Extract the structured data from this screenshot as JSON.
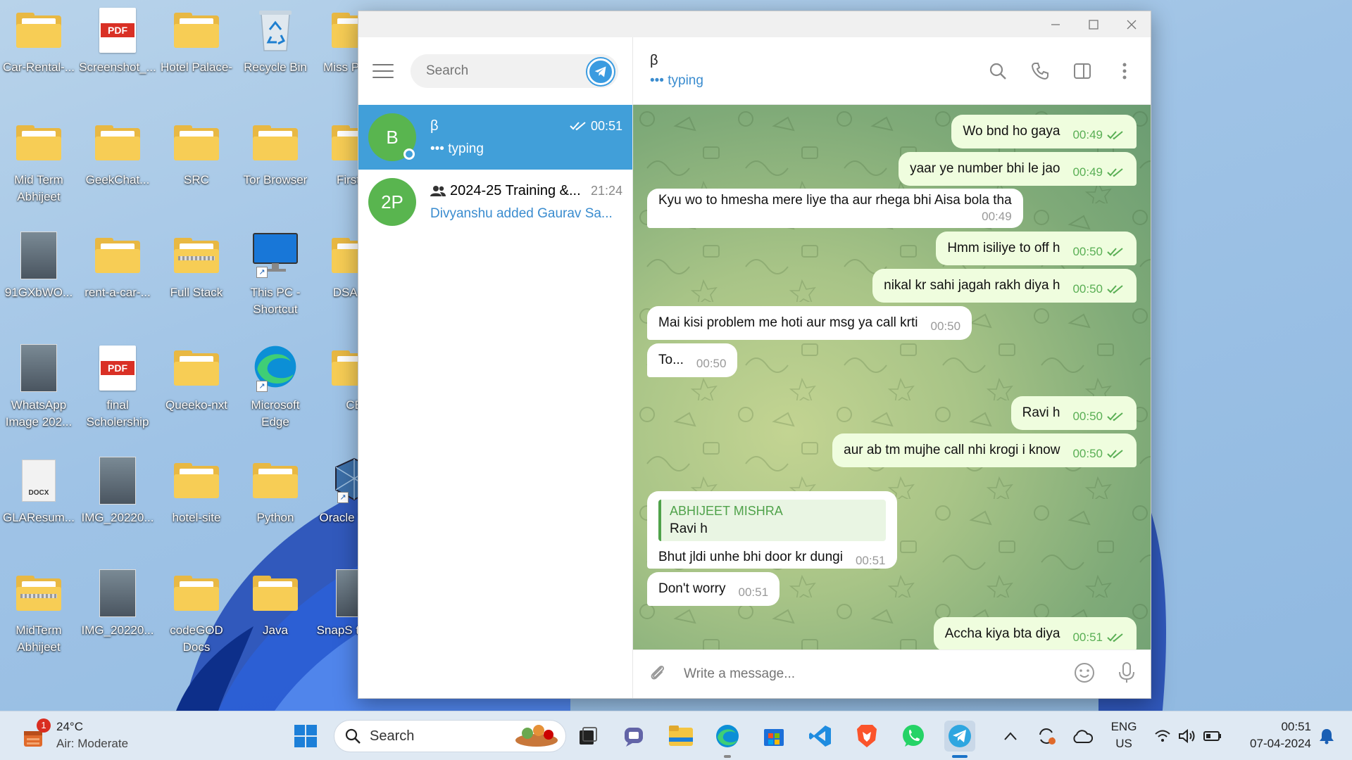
{
  "desktop": {
    "icons": [
      {
        "label": "Car-Rental-...",
        "type": "folder"
      },
      {
        "label": "Screenshot_...",
        "type": "pdf"
      },
      {
        "label": "Hotel Palace-",
        "type": "folder"
      },
      {
        "label": "Recycle Bin",
        "type": "recycle-bin"
      },
      {
        "label": "Miss Projec",
        "type": "folder"
      },
      {
        "label": "Mid Term Abhijeet",
        "type": "folder"
      },
      {
        "label": "GeekChat...",
        "type": "folder"
      },
      {
        "label": "SRC",
        "type": "folder"
      },
      {
        "label": "Tor Browser",
        "type": "folder"
      },
      {
        "label": "FirstPr",
        "type": "folder"
      },
      {
        "label": "91GXbWO...",
        "type": "image"
      },
      {
        "label": "rent-a-car-...",
        "type": "folder"
      },
      {
        "label": "Full Stack",
        "type": "zip-folder"
      },
      {
        "label": "This PC - Shortcut",
        "type": "monitor"
      },
      {
        "label": "DSA Co",
        "type": "folder"
      },
      {
        "label": "WhatsApp Image 202...",
        "type": "image"
      },
      {
        "label": "final Scholership",
        "type": "pdf"
      },
      {
        "label": "Queeko-nxt",
        "type": "folder"
      },
      {
        "label": "Microsoft Edge",
        "type": "edge"
      },
      {
        "label": "CE",
        "type": "folder"
      },
      {
        "label": "GLAResum...",
        "type": "docx"
      },
      {
        "label": "IMG_20220...",
        "type": "image"
      },
      {
        "label": "hotel-site",
        "type": "folder"
      },
      {
        "label": "Python",
        "type": "folder"
      },
      {
        "label": "Oracle Virtua",
        "type": "app"
      },
      {
        "label": "MidTerm Abhijeet",
        "type": "zip-folder"
      },
      {
        "label": "IMG_20220...",
        "type": "image"
      },
      {
        "label": "codeGOD Docs",
        "type": "folder"
      },
      {
        "label": "Java",
        "type": "folder"
      },
      {
        "label": "SnapS the BA",
        "type": "image"
      }
    ],
    "pdf_badge": "PDF",
    "docx_badge": "DOCX"
  },
  "telegram": {
    "search_placeholder": "Search",
    "chats": [
      {
        "avatar": "B",
        "name": "β",
        "time": "00:51",
        "preview": "••• typing",
        "active": true
      },
      {
        "avatar": "2P",
        "name": "2024-25 Training &...",
        "time": "21:24",
        "preview": "Divyanshu added Gaurav Sa...",
        "active": false
      }
    ],
    "header": {
      "name": "β",
      "status": "••• typing"
    },
    "messages": [
      {
        "dir": "out",
        "text": "Wo bnd ho gaya",
        "time": "00:49"
      },
      {
        "dir": "out",
        "text": "yaar ye number bhi le jao",
        "time": "00:49"
      },
      {
        "dir": "in",
        "text": "Kyu wo to hmesha mere liye tha aur rhega bhi Aisa bola tha",
        "time": "00:49"
      },
      {
        "dir": "out",
        "text": "Hmm isiliye to off h",
        "time": "00:50"
      },
      {
        "dir": "out",
        "text": "nikal kr sahi jagah rakh diya h",
        "time": "00:50"
      },
      {
        "dir": "in",
        "text": "Mai kisi problem me hoti aur msg ya call krti",
        "time": "00:50"
      },
      {
        "dir": "in",
        "text": "To...",
        "time": "00:50"
      },
      {
        "dir": "out",
        "text": "Ravi h",
        "time": "00:50"
      },
      {
        "dir": "out",
        "text": "aur ab tm mujhe call nhi krogi i know",
        "time": "00:50"
      },
      {
        "dir": "in",
        "reply_name": "ABHIJEET MISHRA",
        "reply_text": "Ravi h",
        "text": "Bhut jldi unhe bhi door kr dungi",
        "time": "00:51"
      },
      {
        "dir": "in",
        "text": "Don't worry",
        "time": "00:51"
      },
      {
        "dir": "out",
        "text": "Accha kiya bta diya",
        "time": "00:51"
      }
    ],
    "composer_placeholder": "Write a message..."
  },
  "taskbar": {
    "weather_temp": "24°C",
    "weather_desc": "Air: Moderate",
    "weather_badge": "1",
    "search_label": "Search",
    "lang_line1": "ENG",
    "lang_line2": "US",
    "clock_time": "00:51",
    "clock_date": "07-04-2024"
  },
  "colors": {
    "telegram_active": "#419fd9",
    "outgoing_bubble": "#effdde",
    "check_green": "#5aaf55",
    "avatar_green": "#59b54f"
  }
}
